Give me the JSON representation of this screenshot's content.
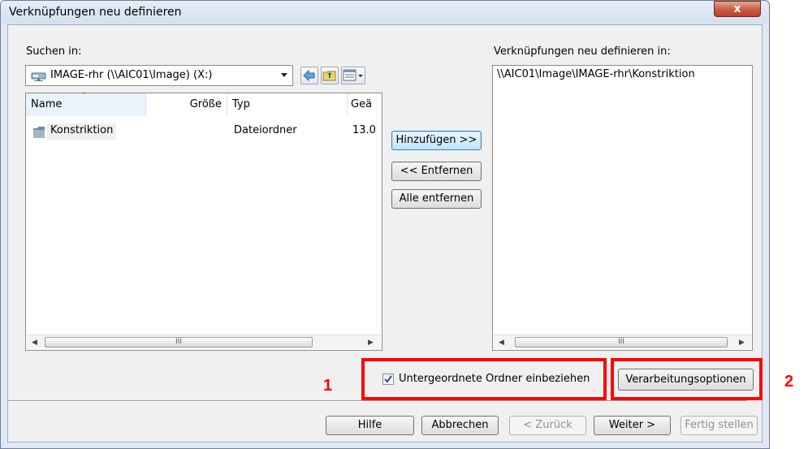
{
  "window": {
    "title": "Verknüpfungen neu definieren",
    "close_glyph": "x"
  },
  "left": {
    "search_label": "Suchen in:",
    "location": "IMAGE-rhr (\\\\AIC01\\Image) (X:)",
    "columns": [
      "Name",
      "Größe",
      "Typ",
      "Geä"
    ],
    "rows": [
      {
        "name": "Konstriktion",
        "size": "",
        "type": "Dateiordner",
        "date": "13.0"
      }
    ],
    "scroll_mark": "III"
  },
  "middle": {
    "add": "Hinzufügen >>",
    "remove": "<< Entfernen",
    "remove_all": "Alle entfernen"
  },
  "right": {
    "label": "Verknüpfungen neu definieren in:",
    "items": [
      "\\\\AIC01\\Image\\IMAGE-rhr\\Konstriktion"
    ],
    "scroll_mark": "III"
  },
  "options": {
    "include_subfolders": "Untergeordnete Ordner einbeziehen",
    "include_subfolders_checked": true,
    "processing_options": "Verarbeitungsoptionen"
  },
  "footer": {
    "help": "Hilfe",
    "cancel": "Abbrechen",
    "back": "< Zurück",
    "next": "Weiter >",
    "finish": "Fertig stellen"
  },
  "annotations": {
    "one": "1",
    "two": "2",
    "color": "#ff0000"
  },
  "icons": [
    "drive-icon",
    "back-arrow-icon",
    "up-folder-icon",
    "view-menu-icon",
    "folder-icon",
    "dropdown-arrow-icon",
    "checkmark-icon",
    "close-icon"
  ]
}
